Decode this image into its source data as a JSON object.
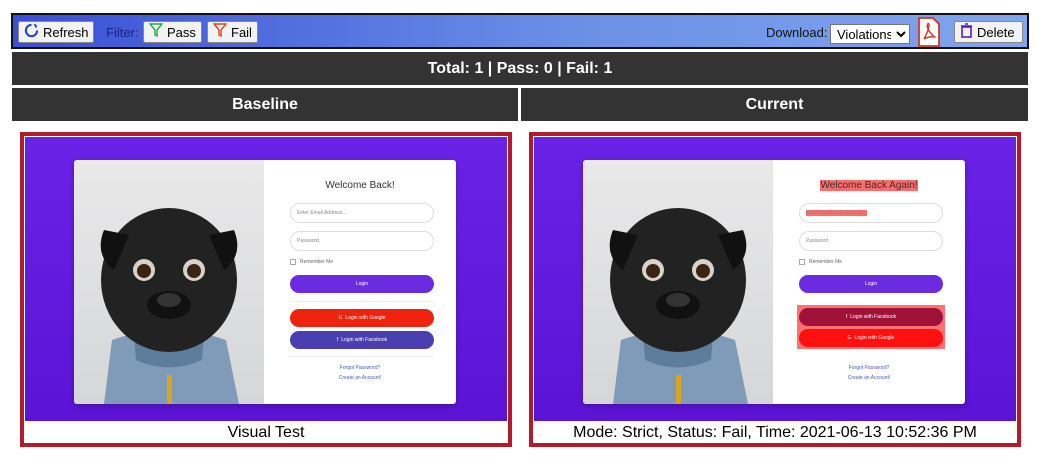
{
  "toolbar": {
    "refresh_label": "Refresh",
    "filter_label": "Filter:",
    "pass_label": "Pass",
    "fail_label": "Fail",
    "download_label": "Download:",
    "download_selected": "Violations",
    "delete_label": "Delete"
  },
  "summary": "Total: 1 | Pass: 0 | Fail: 1",
  "columns": {
    "baseline": "Baseline",
    "current": "Current"
  },
  "baseline": {
    "caption": "Visual Test",
    "form": {
      "title": "Welcome Back!",
      "email_placeholder": "Enter Email Address...",
      "password_placeholder": "Password",
      "remember": "Remember Me",
      "login": "Login",
      "google": "Login with Google",
      "facebook": "Login with Facebook",
      "forgot": "Forgot Password?",
      "create": "Create an Account!"
    }
  },
  "current": {
    "caption": "Mode: Strict, Status: Fail, Time: 2021-06-13 10:52:36 PM",
    "form": {
      "title": "Welcome Back Again!",
      "email_placeholder": "Enter Your Email Address...",
      "password_placeholder": "Password",
      "remember": "Remember Me",
      "login": "Login",
      "facebook": "Login with Facebook",
      "google": "Login with Google",
      "forgot": "Forgot Password?",
      "create": "Create an Account!"
    }
  },
  "colors": {
    "violation_border": "#b31b2a",
    "header_bar": "#333333",
    "login_purple": "#6b2be0",
    "google_red": "#f0230f",
    "facebook_blue": "#4a3fb0"
  }
}
